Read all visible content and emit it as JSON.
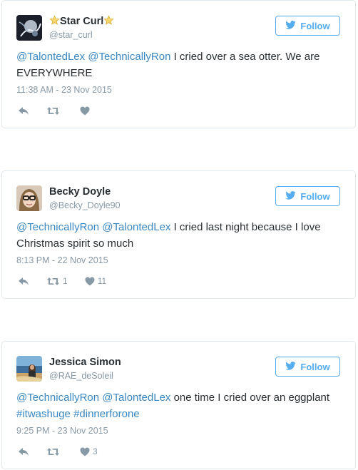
{
  "tweets": [
    {
      "name": "Star Curl",
      "name_prefix_icon": "star-emoji",
      "name_suffix_icon": "star-emoji",
      "handle": "@star_curl",
      "follow_label": "Follow",
      "text": {
        "mention1": "@TalontedLex",
        "mention2": "@TechnicallyRon",
        "body": " I cried over a sea otter. We are EVERYWHERE"
      },
      "timestamp": "11:38 AM - 23 Nov 2015",
      "retweets": "",
      "likes": ""
    },
    {
      "name": "Becky Doyle",
      "handle": "@Becky_Doyle90",
      "follow_label": "Follow",
      "text": {
        "mention1": "@TechnicallyRon",
        "mention2": "@TalontedLex",
        "body": " I cried last night because I love Christmas spirit so much"
      },
      "timestamp": "8:13 PM - 22 Nov 2015",
      "retweets": "1",
      "likes": "11"
    },
    {
      "name": "Jessica Simon",
      "handle": "@RAE_deSoleil",
      "follow_label": "Follow",
      "text": {
        "mention1": "@TechnicallyRon",
        "mention2": "@TalontedLex",
        "body": " one time I cried over an eggplant ",
        "hashtag1": "#itwashuge",
        "hashtag2": "#dinnerforone"
      },
      "timestamp": "9:25 PM - 23 Nov 2015",
      "retweets": "",
      "likes": "3"
    }
  ],
  "colors": {
    "accent": "#55acee",
    "link": "#3b88c3",
    "muted": "#8899a6",
    "border": "#e1e8ed",
    "text": "#292f33"
  }
}
